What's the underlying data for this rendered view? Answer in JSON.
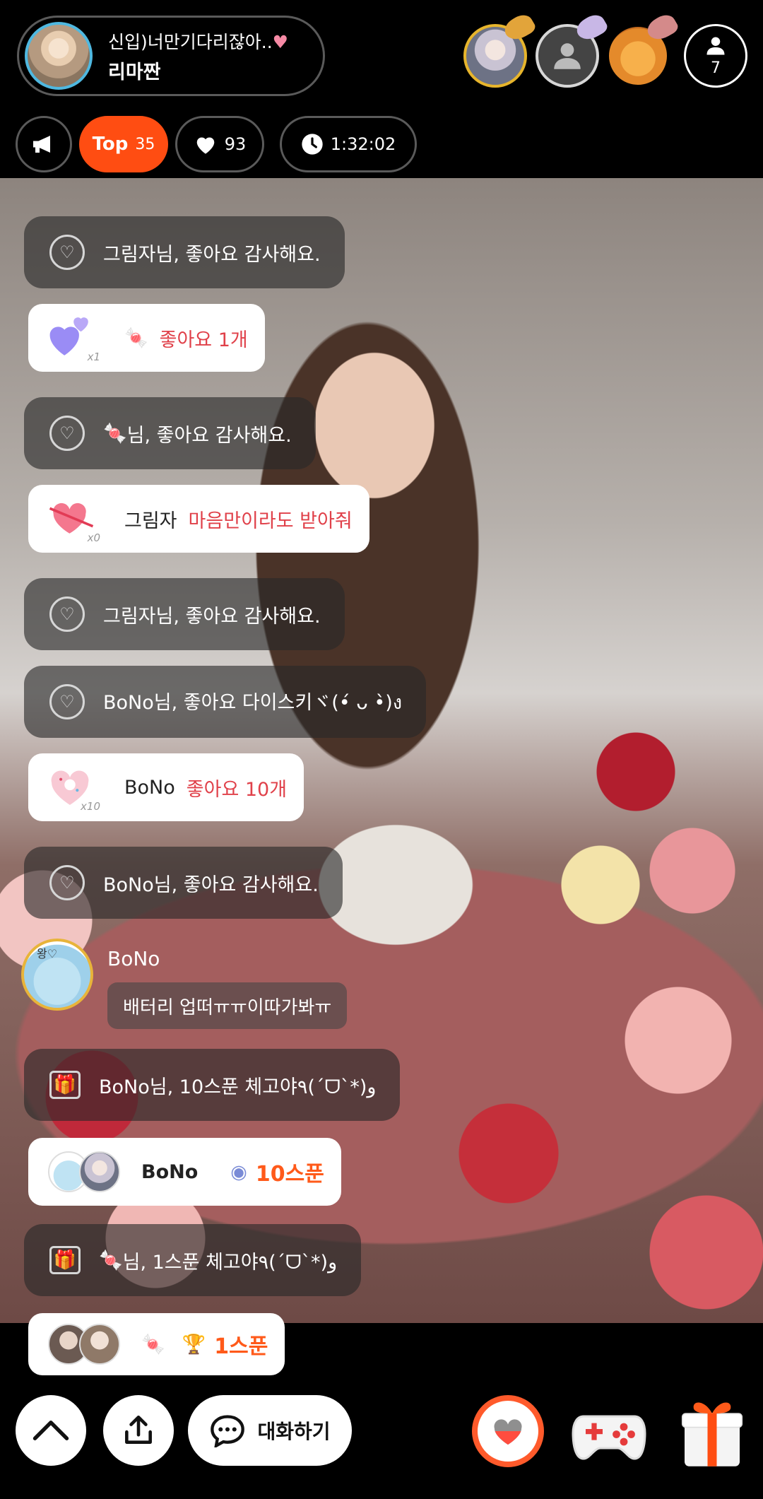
{
  "header": {
    "host_title": "신입)너만기다리잖아..",
    "host_name": "리마짠",
    "viewer_count": "7",
    "top_label": "Top",
    "top_rank": "35",
    "like_count": "93",
    "elapsed_time": "1:32:02"
  },
  "chat": {
    "messages": [
      {
        "type": "system",
        "text": "그림자님, 좋아요 감사해요."
      },
      {
        "type": "like_card",
        "label": "좋아요 1개",
        "qty": "x1"
      },
      {
        "type": "system",
        "text": "님, 좋아요 감사해요."
      },
      {
        "type": "like_card",
        "name": "그림자",
        "label": "마음만이라도 받아줘",
        "qty": "x0"
      },
      {
        "type": "system",
        "text": "그림자님, 좋아요 감사해요."
      },
      {
        "type": "system",
        "text": "BoNo님, 좋아요 다이스키ヾ(•́ ᴗ •̀)ง"
      },
      {
        "type": "like_card",
        "name": "BoNo",
        "label": "좋아요 10개",
        "qty": "x10"
      },
      {
        "type": "system",
        "text": "BoNo님, 좋아요 감사해요."
      },
      {
        "type": "user",
        "avatar_tag": "왕♡",
        "name": "BoNo",
        "text": "배터리 업떠ㅠㅠ이따가봐ㅠ"
      },
      {
        "type": "gift_system",
        "text": "BoNo님, 10스푼 체고야٩(ˊᗜˋ*)و"
      },
      {
        "type": "spoon_card",
        "name": "BoNo",
        "amount": "10스푼"
      },
      {
        "type": "gift_system",
        "text": "님, 1스푼 체고야٩(ˊᗜˋ*)و"
      },
      {
        "type": "spoon_card",
        "amount": "1스푼"
      }
    ]
  },
  "bottom": {
    "chat_label": "대화하기"
  },
  "icons": {
    "announce": "megaphone-icon",
    "like": "heart-icon",
    "clock": "clock-icon",
    "viewer": "person-icon",
    "up": "chevron-up-icon",
    "share": "share-icon",
    "chat": "speech-bubble-icon",
    "game": "gamepad-icon",
    "gift": "gift-icon"
  },
  "colors": {
    "accent": "#ff4d12",
    "highlight_red": "#e0414a",
    "spoon_orange": "#ff5a1a"
  }
}
